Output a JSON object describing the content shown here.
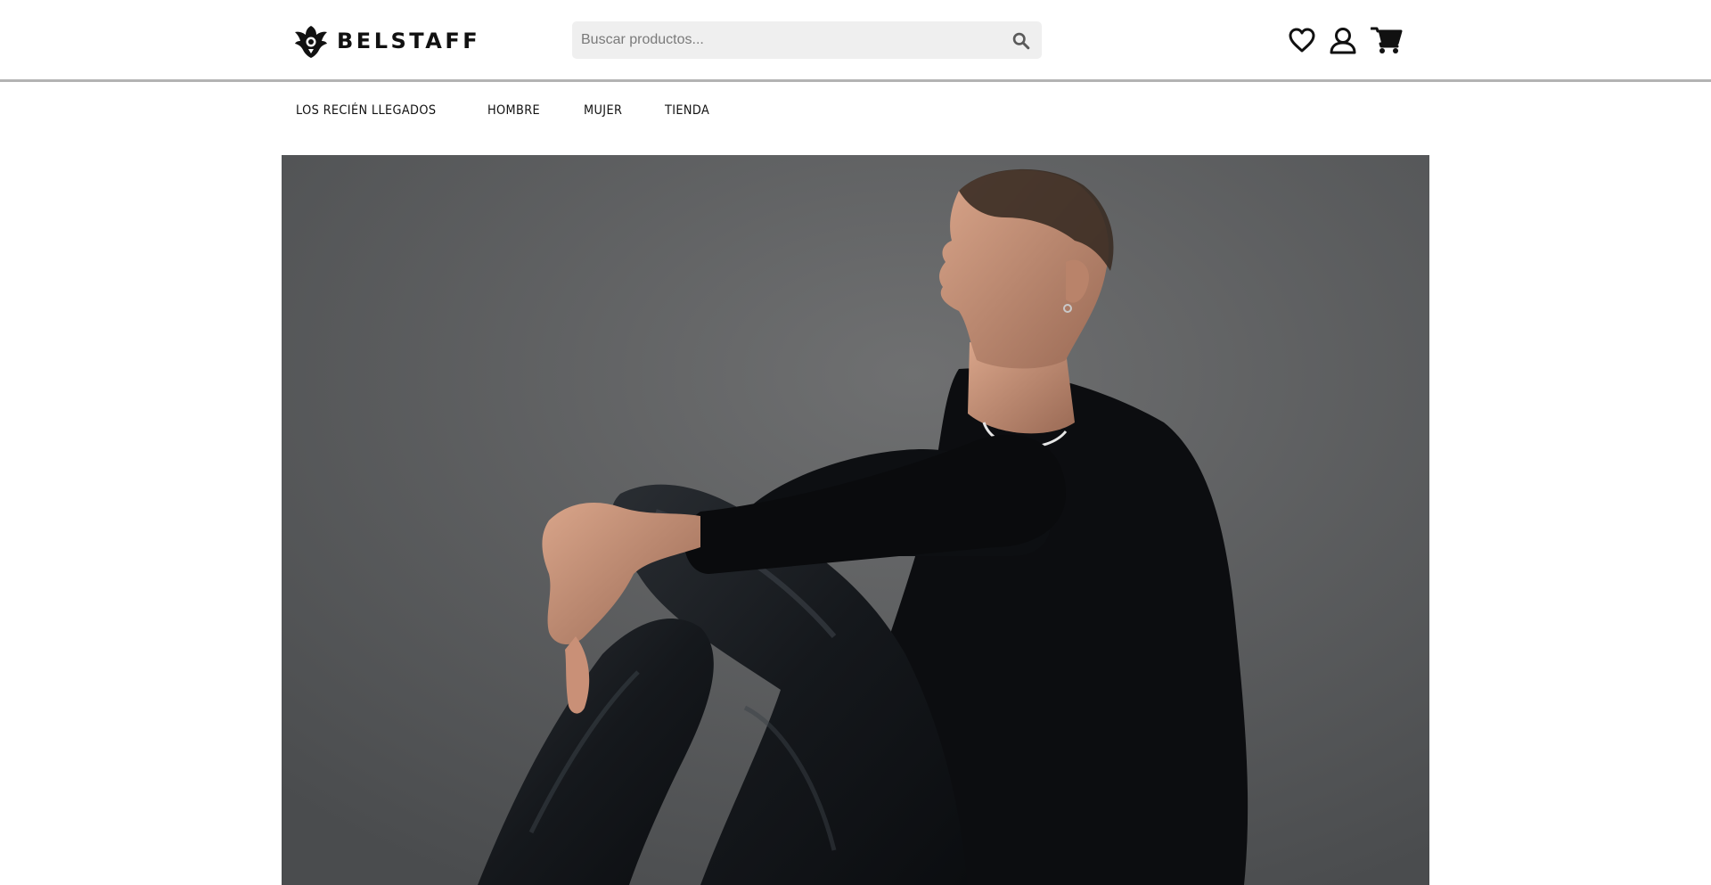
{
  "brand": {
    "name": "BELSTAFF",
    "logo_icon": "phoenix-icon"
  },
  "search": {
    "placeholder": "Buscar productos...",
    "icon": "search-icon"
  },
  "header_icons": [
    "heart-icon",
    "user-icon",
    "cart-icon"
  ],
  "nav": {
    "items": [
      {
        "label": "LOS RECIÉN LLEGADOS"
      },
      {
        "label": "HOMBRE"
      },
      {
        "label": "MUJER"
      },
      {
        "label": "TIENDA"
      }
    ]
  },
  "colors": {
    "header_border": "#b3b3b3",
    "search_bg": "#efefef",
    "hero_bg": "#5f6061"
  }
}
